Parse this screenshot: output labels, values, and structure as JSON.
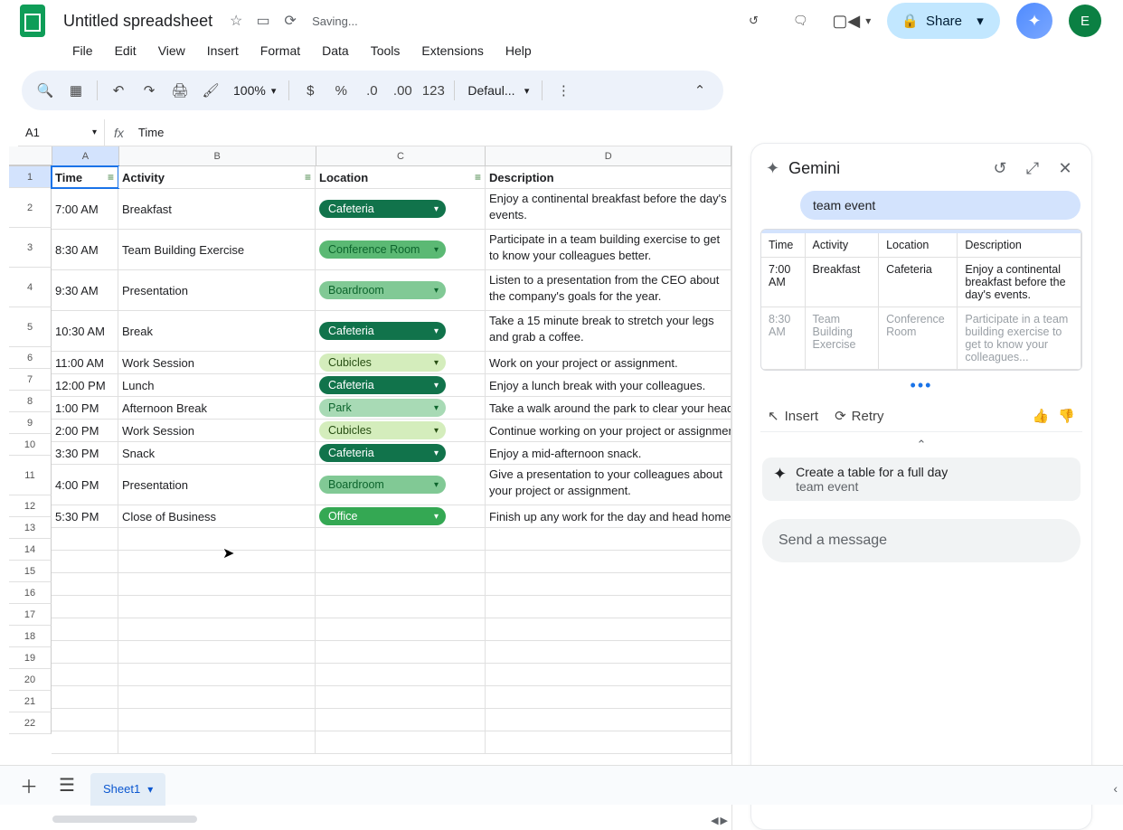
{
  "doc": {
    "title": "Untitled spreadsheet",
    "saving": "Saving..."
  },
  "menus": {
    "file": "File",
    "edit": "Edit",
    "view": "View",
    "insert": "Insert",
    "format": "Format",
    "data": "Data",
    "tools": "Tools",
    "extensions": "Extensions",
    "help": "Help"
  },
  "share": {
    "label": "Share"
  },
  "avatar": {
    "initial": "E"
  },
  "toolbar": {
    "zoom": "100%",
    "font": "Defaul...",
    "num_format": "123"
  },
  "fx": {
    "name": "A1",
    "value": "Time"
  },
  "columns": {
    "A": "A",
    "B": "B",
    "C": "C",
    "D": "D"
  },
  "headers": {
    "time": "Time",
    "activity": "Activity",
    "location": "Location",
    "description": "Description"
  },
  "rows": [
    {
      "n": "2",
      "time": "7:00 AM",
      "activity": "Breakfast",
      "loc": "Cafeteria",
      "loc_style": "cafeteria",
      "desc": "Enjoy a continental breakfast before the day's events."
    },
    {
      "n": "3",
      "time": "8:30 AM",
      "activity": "Team Building Exercise",
      "loc": "Conference Room",
      "loc_style": "confroom",
      "desc": "Participate in a team building exercise to get to know your colleagues better."
    },
    {
      "n": "4",
      "time": "9:30 AM",
      "activity": "Presentation",
      "loc": "Boardroom",
      "loc_style": "boardroom",
      "desc": "Listen to a presentation from the CEO about the company's goals for the year."
    },
    {
      "n": "5",
      "time": "10:30 AM",
      "activity": "Break",
      "loc": "Cafeteria",
      "loc_style": "cafeteria",
      "desc": "Take a 15 minute break to stretch your legs and grab a coffee."
    },
    {
      "n": "6",
      "time": "11:00 AM",
      "activity": "Work Session",
      "loc": "Cubicles",
      "loc_style": "cubicles",
      "desc": "Work on your project or assignment."
    },
    {
      "n": "7",
      "time": "12:00 PM",
      "activity": "Lunch",
      "loc": "Cafeteria",
      "loc_style": "cafeteria",
      "desc": "Enjoy a lunch break with your colleagues."
    },
    {
      "n": "8",
      "time": "1:00 PM",
      "activity": "Afternoon Break",
      "loc": "Park",
      "loc_style": "park",
      "desc": "Take a walk around the park to clear your head."
    },
    {
      "n": "9",
      "time": "2:00 PM",
      "activity": "Work Session",
      "loc": "Cubicles",
      "loc_style": "cubicles",
      "desc": "Continue working on your project or assignment."
    },
    {
      "n": "10",
      "time": "3:30 PM",
      "activity": "Snack",
      "loc": "Cafeteria",
      "loc_style": "cafeteria",
      "desc": "Enjoy a mid-afternoon snack."
    },
    {
      "n": "11",
      "time": "4:00 PM",
      "activity": "Presentation",
      "loc": "Boardroom",
      "loc_style": "boardroom",
      "desc": "Give a presentation to your colleagues about your project or assignment."
    },
    {
      "n": "12",
      "time": "5:30 PM",
      "activity": "Close of Business",
      "loc": "Office",
      "loc_style": "office",
      "desc": "Finish up any work for the day and head home."
    }
  ],
  "empty_rows": [
    "13",
    "14",
    "15",
    "16",
    "17",
    "18",
    "19",
    "20",
    "21",
    "22"
  ],
  "tabs": {
    "sheet1": "Sheet1"
  },
  "gemini": {
    "title": "Gemini",
    "chip": "team event",
    "th": {
      "time": "Time",
      "activity": "Activity",
      "location": "Location",
      "description": "Description"
    },
    "r1": {
      "time": "7:00 AM",
      "activity": "Breakfast",
      "location": "Cafeteria",
      "desc": "Enjoy a continental breakfast before the day's events."
    },
    "r2": {
      "time": "8:30 AM",
      "activity": "Team Building Exercise",
      "location": "Conference Room",
      "desc": "Participate in a team building exercise to get to know your colleagues..."
    },
    "actions": {
      "insert": "Insert",
      "retry": "Retry"
    },
    "sugg": {
      "title": "Create a table for a full day",
      "sub": "team event"
    },
    "input_placeholder": "Send a message"
  }
}
